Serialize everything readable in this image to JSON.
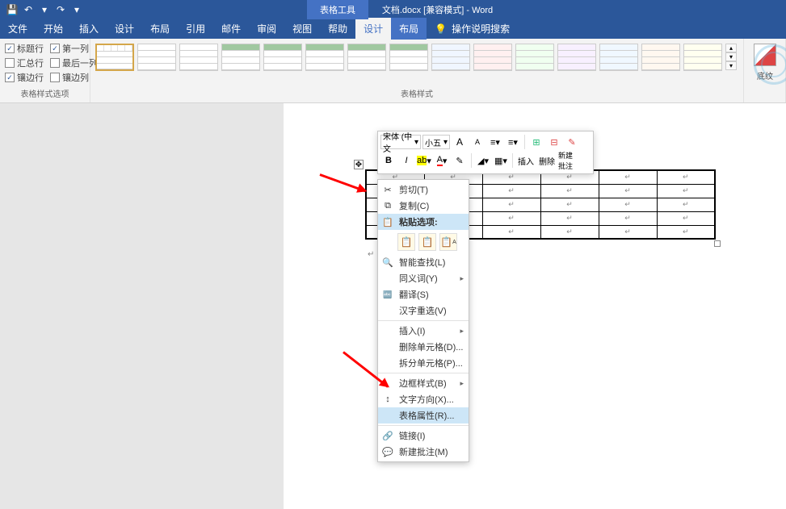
{
  "title": {
    "tool_tab": "表格工具",
    "doc_name": "文档.docx [兼容模式] - Word"
  },
  "qat": {
    "save": "💾",
    "undo": "↶",
    "redo": "↷",
    "dropdown": "▾"
  },
  "tabs": {
    "file": "文件",
    "home": "开始",
    "insert": "插入",
    "design": "设计",
    "layout": "布局",
    "references": "引用",
    "mailings": "邮件",
    "review": "审阅",
    "view": "视图",
    "help": "帮助",
    "tbl_design": "设计",
    "tbl_layout": "布局",
    "tell_me": "操作说明搜索",
    "tell_me_icon": "💡"
  },
  "ribbon": {
    "options": {
      "header_row": "标题行",
      "first_col": "第一列",
      "total_row": "汇总行",
      "last_col": "最后一列",
      "banded_row": "镶边行",
      "banded_col": "镶边列",
      "group_label": "表格样式选项"
    },
    "styles_label": "表格样式",
    "shading_label": "底纹"
  },
  "mini_toolbar": {
    "font": "宋体 (中文",
    "size": "小五",
    "bold": "B",
    "italic": "I",
    "insert": "插入",
    "delete": "删除",
    "new_comment_l1": "新建",
    "new_comment_l2": "批注"
  },
  "context_menu": {
    "cut": "剪切(T)",
    "copy": "复制(C)",
    "paste_opts": "粘贴选项:",
    "smart_lookup": "智能查找(L)",
    "synonyms": "同义词(Y)",
    "translate": "翻译(S)",
    "reconvert": "汉字重选(V)",
    "insert": "插入(I)",
    "delete_cells": "删除单元格(D)...",
    "split_cells": "拆分单元格(P)...",
    "border_style": "边框样式(B)",
    "text_direction": "文字方向(X)...",
    "table_props": "表格属性(R)...",
    "link": "链接(I)",
    "new_comment": "新建批注(M)"
  },
  "icons": {
    "cut": "✂",
    "copy": "⧉",
    "paste": "📋",
    "search": "🔍",
    "translate": "🔤",
    "text_dir": "↕",
    "link": "🔗",
    "comment": "💬",
    "paste1": "📋",
    "paste2": "📋",
    "paste3": "📋",
    "submenu": "▸",
    "scroll_up": "▴",
    "scroll_down": "▾",
    "scroll_more": "▾",
    "move_handle": "✥",
    "font_grow": "A",
    "font_shrink": "A",
    "format_painter": "✎",
    "highlight": "▬",
    "font_color": "A",
    "fill": "◢",
    "border": "▦",
    "insert_tbl": "⊞",
    "delete_tbl": "⊟"
  },
  "para_mark": "↵"
}
